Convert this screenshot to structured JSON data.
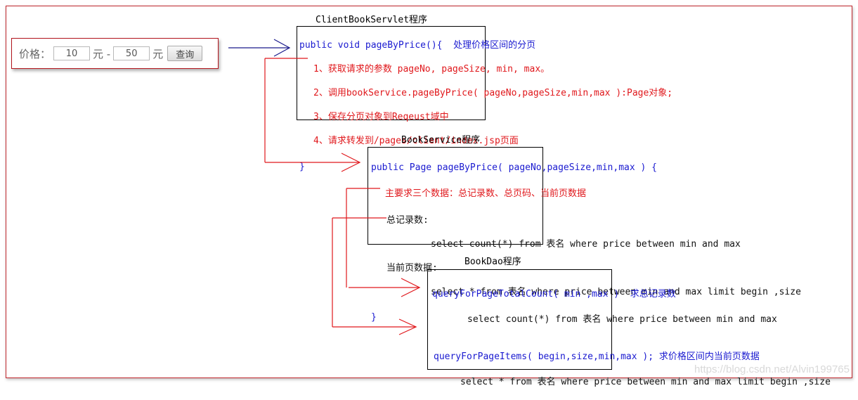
{
  "search_form": {
    "price_label": "价格：",
    "min_value": "10",
    "unit_min": "元 -",
    "max_value": "50",
    "unit_max": "元",
    "query_button": "查询"
  },
  "servlet": {
    "title": "ClientBookServlet程序",
    "signature": "public void pageByPrice(){",
    "comment": "  处理价格区间的分页",
    "steps": [
      "1、获取请求的参数 pageNo, pageSize, min, max。",
      "2、调用bookService.pageByPrice( pageNo,pageSize,min,max ):Page对象;",
      "3、保存分页对象到Reqeust域中",
      "4、请求转发到/pages/client/index.jsp页面"
    ],
    "closing": "}"
  },
  "service": {
    "title": "BookService程序",
    "signature": "public Page pageByPrice( pageNo,pageSize,min,max ) {",
    "note": "主要求三个数据：总记录数、总页码、当前页数据",
    "total_label": "总记录数:",
    "total_sql": "select count(*) from 表名 where price between min and max",
    "page_label": "当前页数据:",
    "page_sql": "select * from 表名 where price between min and max limit begin ,size",
    "closing": "}"
  },
  "dao": {
    "title": "BookDao程序",
    "count_method": "queryForPageTotalCount( min ,max )",
    "count_comment": "  求总记录数",
    "count_sql": "select count(*) from 表名 where price between min and max",
    "items_method": "queryForPageItems( begin,size,min,max );",
    "items_comment": " 求价格区间内当前页数据",
    "items_sql": "select * from 表名 where price between min and max limit begin ,size"
  },
  "colors": {
    "frame_border": "#c0262c",
    "code_blue": "#1a1ad0",
    "code_red": "#e0181c",
    "arrow_blue": "#1a1a8c",
    "arrow_red": "#e0181c"
  },
  "watermark": "https://blog.csdn.net/Alvin199765"
}
